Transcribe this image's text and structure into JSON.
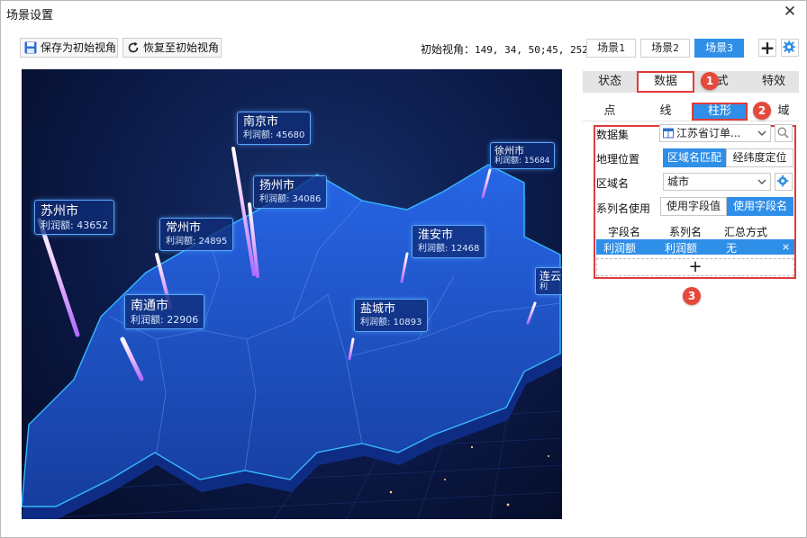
{
  "window": {
    "title": "场景设置",
    "close_label": "✕"
  },
  "toolbar": {
    "save_view_label": "保存为初始视角",
    "restore_view_label": "恢复至初始视角",
    "initial_view_label": "初始视角：",
    "initial_view_value": "149, 34, 50;45, 252, 0",
    "scenes": [
      {
        "label": "场景",
        "num": "1",
        "active": false
      },
      {
        "label": "场景",
        "num": "2",
        "active": false
      },
      {
        "label": "场景",
        "num": "3",
        "active": true
      }
    ],
    "add_label": "+"
  },
  "map": {
    "cities": [
      {
        "name": "苏州市",
        "value_label": "利润额: 43652"
      },
      {
        "name": "南京市",
        "value_label": "利润额: 45680"
      },
      {
        "name": "扬州市",
        "value_label": "利润额: 34086"
      },
      {
        "name": "常州市",
        "value_label": "利润额: 24895"
      },
      {
        "name": "南通市",
        "value_label": "利润额: 22906"
      },
      {
        "name": "淮安市",
        "value_label": "利润额: 12468"
      },
      {
        "name": "盐城市",
        "value_label": "利润额: 10893"
      },
      {
        "name": "徐州市",
        "value_label": "利润额: 15684"
      },
      {
        "name": "连云",
        "value_label": "利"
      }
    ]
  },
  "panel": {
    "tabs": [
      {
        "label": "状态"
      },
      {
        "label": "数据"
      },
      {
        "label": "式"
      },
      {
        "label": "特效"
      }
    ],
    "subtabs": [
      {
        "label": "点"
      },
      {
        "label": "线"
      },
      {
        "label": "柱形"
      },
      {
        "label": "域"
      }
    ],
    "badges": [
      "1",
      "2",
      "3"
    ],
    "dataset_label": "数据集",
    "dataset_value": "江苏省订单...",
    "geo_label": "地理位置",
    "geo_options": [
      "区域名匹配",
      "经纬度定位"
    ],
    "region_label": "区域名",
    "region_value": "城市",
    "series_label": "系列名使用",
    "series_options": [
      "使用字段值",
      "使用字段名"
    ],
    "grid_headers": [
      "字段名",
      "系列名",
      "汇总方式"
    ],
    "grid_row": {
      "field": "利润额",
      "series": "利润额",
      "agg": "无"
    },
    "add_label": "+"
  },
  "colors": {
    "accent": "#2f8fe8",
    "highlight_red": "#e03a3a",
    "badge_red": "#e5483c",
    "map_blue": "#1b4fd0"
  }
}
